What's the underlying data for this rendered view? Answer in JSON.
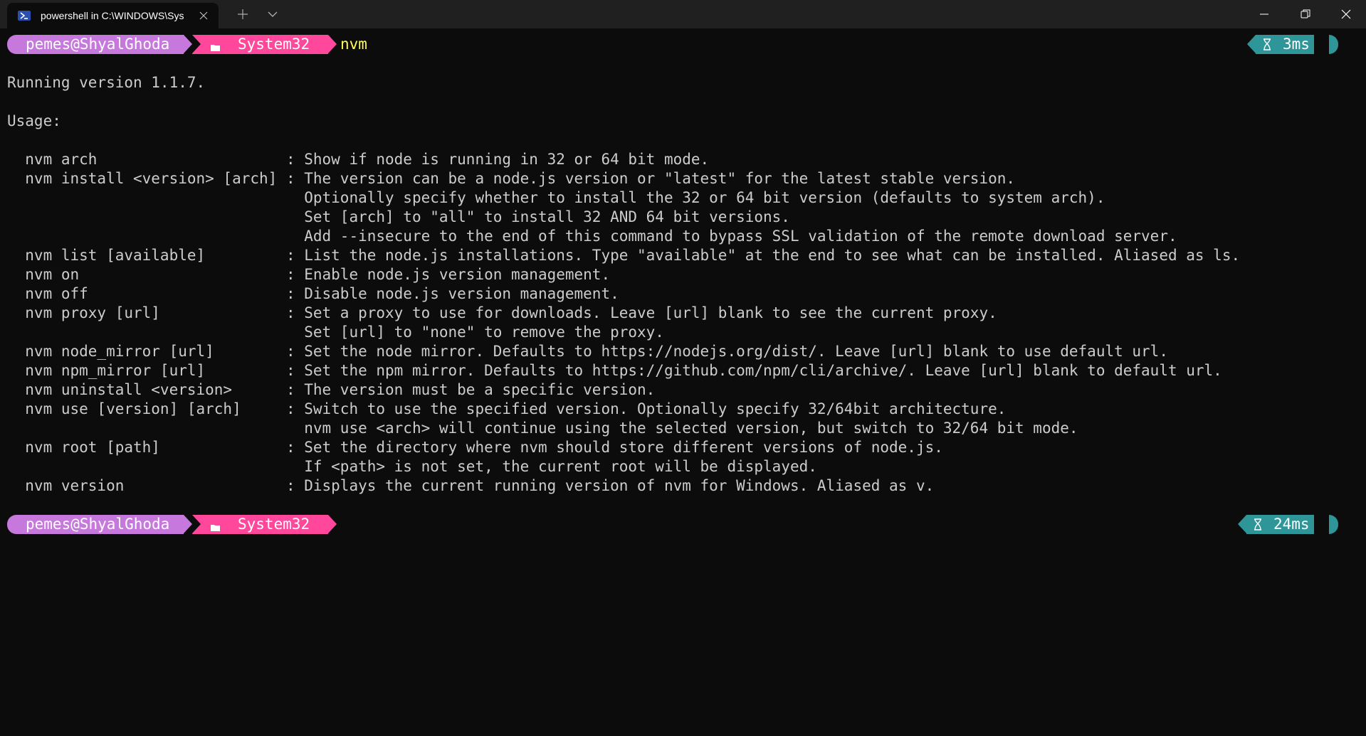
{
  "window": {
    "tab_title": "powershell in C:\\WINDOWS\\Sys",
    "colors": {
      "titlebar": "#202020",
      "background": "#0c0c0c",
      "text": "#cccccc"
    }
  },
  "prompt1": {
    "user": "pemes@ShyalGhoda",
    "folder_icon": "folder-icon",
    "path": "System32",
    "command": "nvm",
    "time": "3ms"
  },
  "output": {
    "version_line": "Running version 1.1.7.",
    "usage_label": "Usage:",
    "rows": [
      {
        "cmd": "  nvm arch                     ",
        "desc": ": Show if node is running in 32 or 64 bit mode."
      },
      {
        "cmd": "  nvm install <version> [arch] ",
        "desc": ": The version can be a node.js version or \"latest\" for the latest stable version."
      },
      {
        "cmd": "                               ",
        "desc": "  Optionally specify whether to install the 32 or 64 bit version (defaults to system arch)."
      },
      {
        "cmd": "                               ",
        "desc": "  Set [arch] to \"all\" to install 32 AND 64 bit versions."
      },
      {
        "cmd": "                               ",
        "desc": "  Add --insecure to the end of this command to bypass SSL validation of the remote download server."
      },
      {
        "cmd": "  nvm list [available]         ",
        "desc": ": List the node.js installations. Type \"available\" at the end to see what can be installed. Aliased as ls."
      },
      {
        "cmd": "  nvm on                       ",
        "desc": ": Enable node.js version management."
      },
      {
        "cmd": "  nvm off                      ",
        "desc": ": Disable node.js version management."
      },
      {
        "cmd": "  nvm proxy [url]              ",
        "desc": ": Set a proxy to use for downloads. Leave [url] blank to see the current proxy."
      },
      {
        "cmd": "                               ",
        "desc": "  Set [url] to \"none\" to remove the proxy."
      },
      {
        "cmd": "  nvm node_mirror [url]        ",
        "desc": ": Set the node mirror. Defaults to https://nodejs.org/dist/. Leave [url] blank to use default url."
      },
      {
        "cmd": "  nvm npm_mirror [url]         ",
        "desc": ": Set the npm mirror. Defaults to https://github.com/npm/cli/archive/. Leave [url] blank to default url."
      },
      {
        "cmd": "  nvm uninstall <version>      ",
        "desc": ": The version must be a specific version."
      },
      {
        "cmd": "  nvm use [version] [arch]     ",
        "desc": ": Switch to use the specified version. Optionally specify 32/64bit architecture."
      },
      {
        "cmd": "                               ",
        "desc": "  nvm use <arch> will continue using the selected version, but switch to 32/64 bit mode."
      },
      {
        "cmd": "  nvm root [path]              ",
        "desc": ": Set the directory where nvm should store different versions of node.js."
      },
      {
        "cmd": "                               ",
        "desc": "  If <path> is not set, the current root will be displayed."
      },
      {
        "cmd": "  nvm version                  ",
        "desc": ": Displays the current running version of nvm for Windows. Aliased as v."
      }
    ]
  },
  "prompt2": {
    "user": "pemes@ShyalGhoda",
    "folder_icon": "folder-icon",
    "path": "System32",
    "time": "24ms"
  },
  "segment_colors": {
    "user": "#c678dd",
    "path": "#ff479c",
    "time": "#2e9599",
    "command": "#ffff55"
  }
}
